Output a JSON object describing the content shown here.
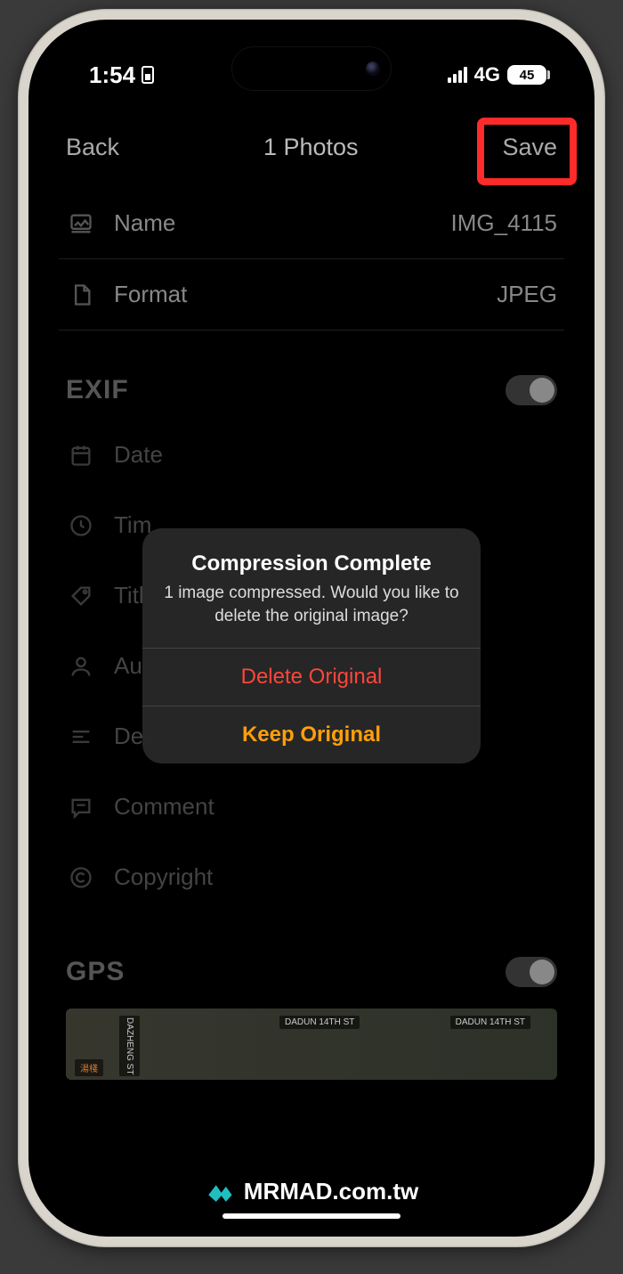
{
  "status": {
    "time": "1:54",
    "network": "4G",
    "battery": "45"
  },
  "nav": {
    "back": "Back",
    "title": "1 Photos",
    "save": "Save"
  },
  "info": {
    "name_label": "Name",
    "name_value": "IMG_4115",
    "format_label": "Format",
    "format_value": "JPEG"
  },
  "sections": {
    "exif": "EXIF",
    "gps": "GPS"
  },
  "exif_rows": {
    "date": "Date",
    "time": "Tim",
    "title": "Titl",
    "author": "Au",
    "description": "Description",
    "comment": "Comment",
    "copyright": "Copyright"
  },
  "map": {
    "street1": "DAZHENG ST",
    "street2": "DADUN 14TH ST",
    "street3": "DADUN 14TH ST",
    "street4": "湯棧"
  },
  "alert": {
    "title": "Compression Complete",
    "message": "1 image compressed. Would you like to delete the original image?",
    "delete": "Delete Original",
    "keep": "Keep Original"
  },
  "watermark": {
    "text": "MRMAD.com.tw"
  }
}
